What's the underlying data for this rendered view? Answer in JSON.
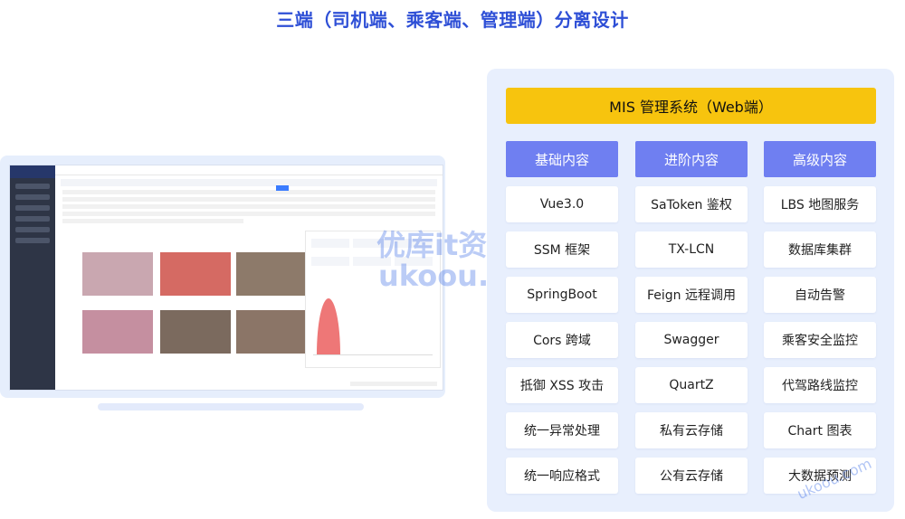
{
  "title": "三端（司机端、乘客端、管理端）分离设计",
  "panel": {
    "header": "MIS 管理系统（Web端）",
    "columns": [
      {
        "heading": "基础内容",
        "items": [
          "Vue3.0",
          "SSM 框架",
          "SpringBoot",
          "Cors 跨域",
          "抵御 XSS 攻击",
          "统一异常处理",
          "统一响应格式"
        ]
      },
      {
        "heading": "进阶内容",
        "items": [
          "SaToken 鉴权",
          "TX-LCN",
          "Feign 远程调用",
          "Swagger",
          "QuartZ",
          "私有云存储",
          "公有云存储"
        ]
      },
      {
        "heading": "高级内容",
        "items": [
          "LBS 地图服务",
          "数据库集群",
          "自动告警",
          "乘客安全监控",
          "代驾路线监控",
          "Chart 图表",
          "大数据预测"
        ]
      }
    ]
  },
  "watermark": {
    "line1": "优库it资源",
    "line2": "ukoou.com",
    "corner": "ukoou.com"
  },
  "colors": {
    "title": "#2e4fd6",
    "header_bg": "#f7c40e",
    "column_head_bg": "#6f7ff1",
    "panel_bg": "#e8effd"
  }
}
